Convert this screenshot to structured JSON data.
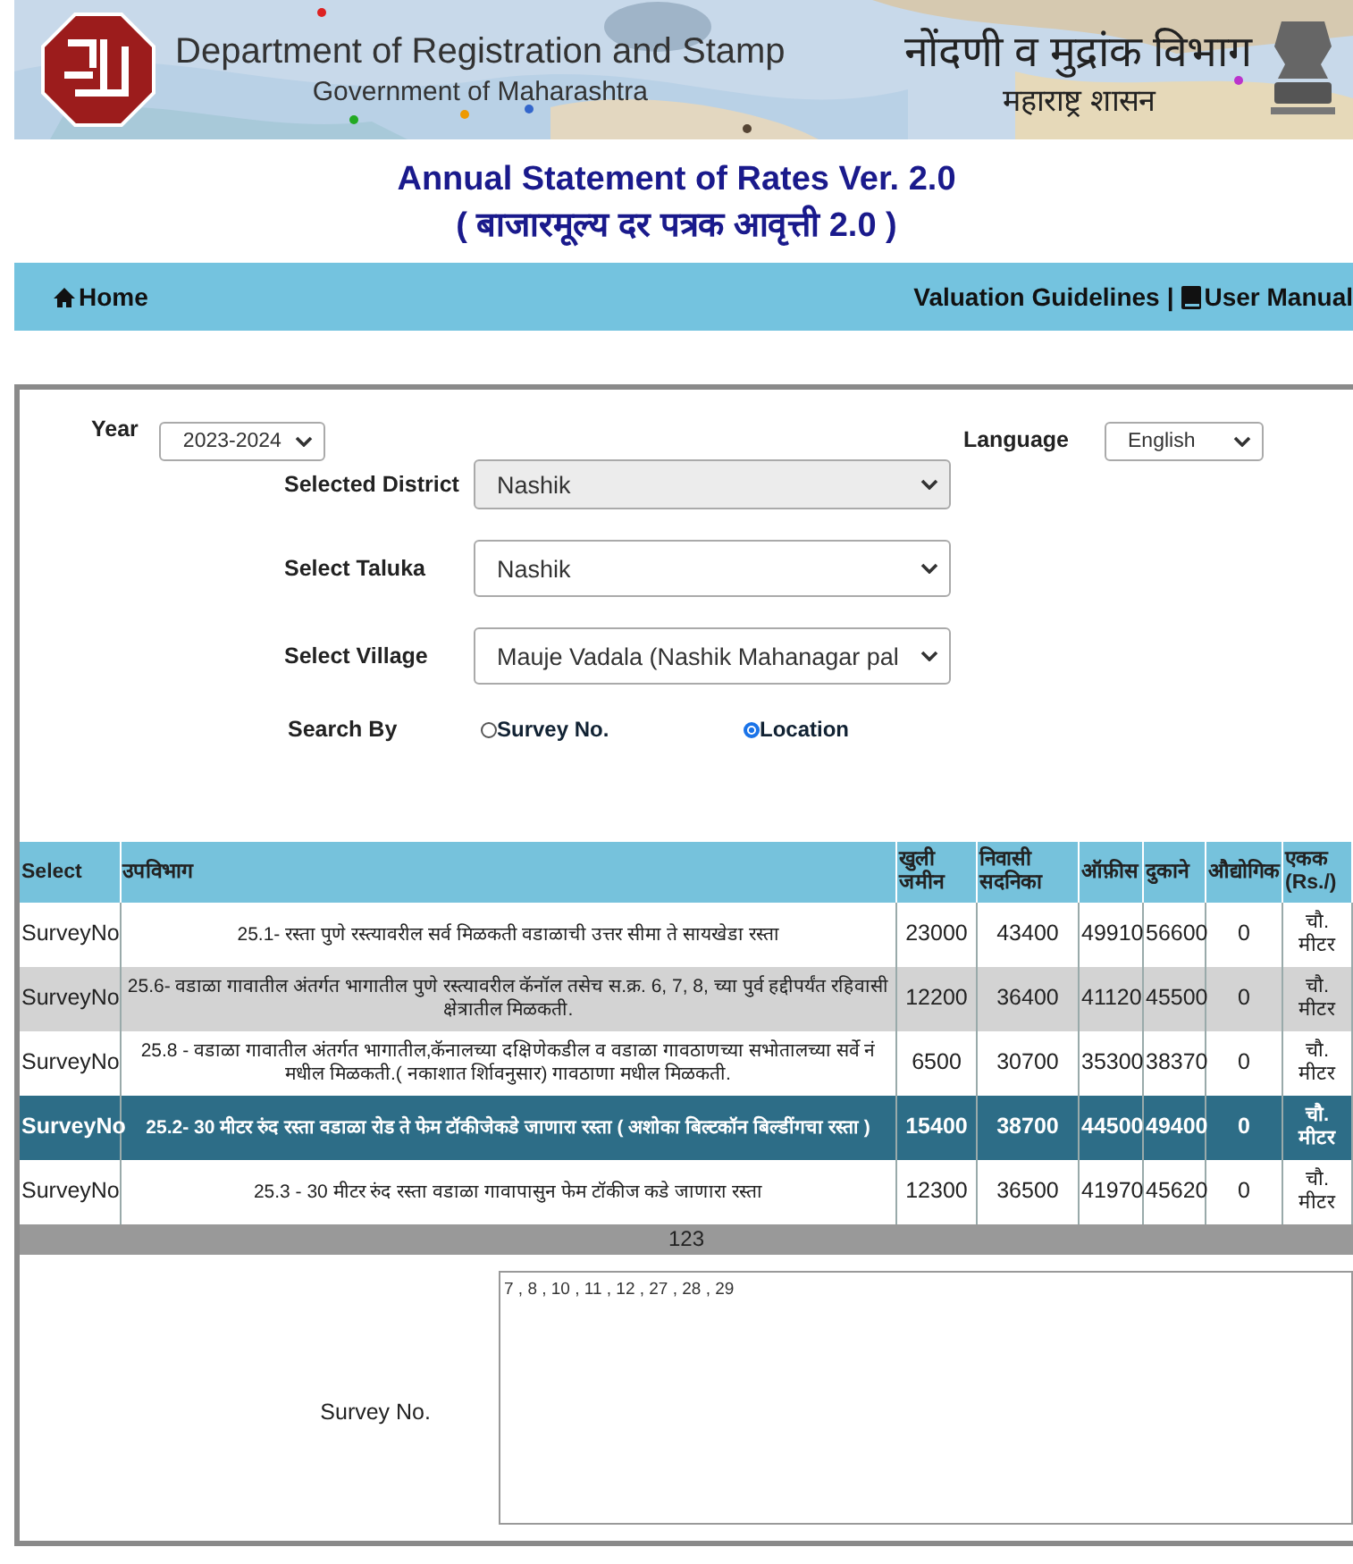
{
  "header": {
    "dept_en": "Department of Registration and Stamp",
    "gov_en": "Government of Maharashtra",
    "dept_mr": "नोंदणी व मुद्रांक विभाग",
    "gov_mr": "महाराष्ट्र शासन"
  },
  "title": "Annual Statement of Rates Ver. 2.0",
  "subtitle": "( बाजारमूल्य दर पत्रक आवृत्ती 2.0 )",
  "nav": {
    "home": "Home",
    "valuation": "Valuation Guidelines",
    "separator": "|",
    "manual": "User Manual"
  },
  "form": {
    "year": {
      "label": "Year",
      "value": "2023-2024"
    },
    "language": {
      "label": "Language",
      "value": "English"
    },
    "fields": [
      {
        "label": "Selected District",
        "value": "Nashik",
        "disabled": true
      },
      {
        "label": "Select Taluka",
        "value": "Nashik",
        "disabled": false
      },
      {
        "label": "Select Village",
        "value": "Mauje Vadala (Nashik Mahanagar pal",
        "disabled": false
      }
    ],
    "search_by": {
      "label": "Search By",
      "options": [
        {
          "label": "Survey No.",
          "selected": false
        },
        {
          "label": "Location",
          "selected": true
        }
      ]
    }
  },
  "table": {
    "columns": [
      "Select",
      "उपविभाग",
      "खुली जमीन",
      "निवासी सदनिका",
      "ऑफ़ीस",
      "दुकाने",
      "औद्योगिक",
      "एकक (Rs./)"
    ],
    "rows": [
      {
        "select": "SurveyNo",
        "description": "25.1- रस्ता पुणे रस्त्यावरील सर्व मिळकती वडाळाची उत्तर सीमा ते सायखेडा रस्ता",
        "values": [
          "23000",
          "43400",
          "49910",
          "56600",
          "0"
        ],
        "unit": "चौ. मीटर",
        "selected": false
      },
      {
        "select": "SurveyNo",
        "description": "25.6- वडाळा गावातील अंतर्गत भागातील पुणे रस्त्यावरील कॅनॉल तसेच स.क्र. 6, 7, 8, च्या पुर्व हद्दीपर्यंत रहिवासी क्षेत्रातील मिळकती.",
        "values": [
          "12200",
          "36400",
          "41120",
          "45500",
          "0"
        ],
        "unit": "चौ. मीटर",
        "selected": false
      },
      {
        "select": "SurveyNo",
        "description": "25.8 - वडाळा गावातील अंतर्गत भागातील,कॅनालच्या दक्षिणेकडील व वडाळा गावठाणच्या सभोतालच्या सर्वे नं मधील मिळकती.( नकाशात र्शािवनुसार) गावठाणा मधील मिळकती.",
        "values": [
          "6500",
          "30700",
          "35300",
          "38370",
          "0"
        ],
        "unit": "चौ. मीटर",
        "selected": false
      },
      {
        "select": "SurveyNo",
        "description": "25.2- 30 मीटर रुंद रस्ता वडाळा रोड ते फेम टॉकीजेकडे जाणारा रस्ता ( अशोका बिल्टकॉन बिल्डींगचा रस्ता )",
        "values": [
          "15400",
          "38700",
          "44500",
          "49400",
          "0"
        ],
        "unit": "चौ. मीटर",
        "selected": true
      },
      {
        "select": "SurveyNo",
        "description": "25.3 - 30 मीटर रुंद रस्ता वडाळा गावापासुन फेम टॉकीज कडे जाणारा रस्ता",
        "values": [
          "12300",
          "36500",
          "41970",
          "45620",
          "0"
        ],
        "unit": "चौ. मीटर",
        "selected": false
      }
    ],
    "pager": "123"
  },
  "survey": {
    "label": "Survey No.",
    "value": "7 , 8 , 10 , 11 , 12 , 27 , 28 , 29"
  }
}
